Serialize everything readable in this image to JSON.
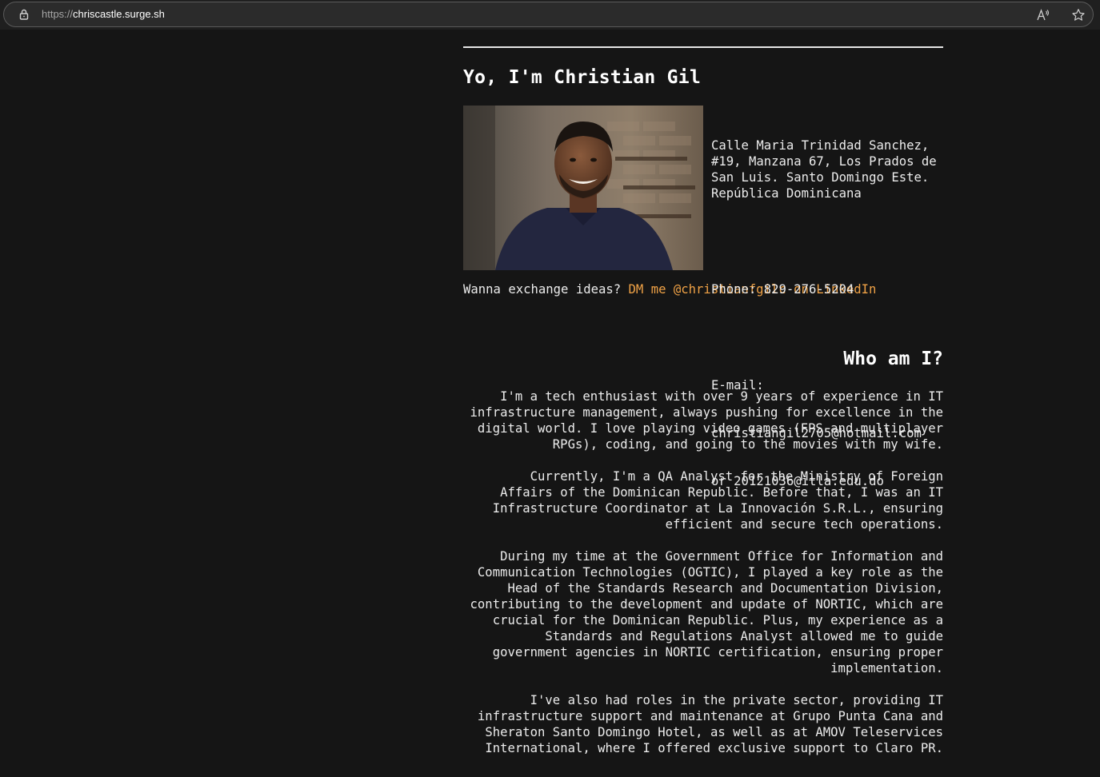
{
  "browser": {
    "url_protocol": "https://",
    "url_host": "chriscastle.surge.sh"
  },
  "header": {
    "title": "Yo, I'm Christian Gil"
  },
  "contact": {
    "address": "Calle Maria Trinidad Sanchez, #19, Manzana 67, Los Prados de San Luis. Santo Domingo Este. República Dominicana",
    "phone": "Phone: 829-276-5204",
    "email_label": "E-mail:",
    "email_primary": "christiangil2705@hotmail.com",
    "email_secondary": "or 20121036@itla.edu.do"
  },
  "cta": {
    "prefix": "Wanna exchange ideas? ",
    "link_text": "DM me @christianfgilc on LinkedIn"
  },
  "about": {
    "heading": "Who am I?",
    "paragraphs": [
      "I'm a tech enthusiast with over 9 years of experience in IT infrastructure management, always pushing for excellence in the digital world. I love playing video games (FPS and multiplayer RPGs), coding, and going to the movies with my wife.",
      "Currently, I'm a QA Analyst for the Ministry of Foreign Affairs of the Dominican Republic. Before that, I was an IT Infrastructure Coordinator at La Innovación S.R.L., ensuring efficient and secure tech operations.",
      "During my time at the Government Office for Information and Communication Technologies (OGTIC), I played a key role as the Head of the Standards Research and Documentation Division, contributing to the development and update of NORTIC, which are crucial for the Dominican Republic. Plus, my experience as a Standards and Regulations Analyst allowed me to guide government agencies in NORTIC certification, ensuring proper implementation.",
      "I've also had roles in the private sector, providing IT infrastructure support and maintenance at Grupo Punta Cana and Sheraton Santo Domingo Hotel, as well as at AMOV Teleservices International, where I offered exclusive support to Claro PR."
    ]
  },
  "colors": {
    "background": "#151515",
    "text": "#ececec",
    "link": "#f0a246"
  },
  "icons": {
    "lock": "lock-icon",
    "read_aloud": "read-aloud-icon",
    "favorite": "star-icon"
  }
}
